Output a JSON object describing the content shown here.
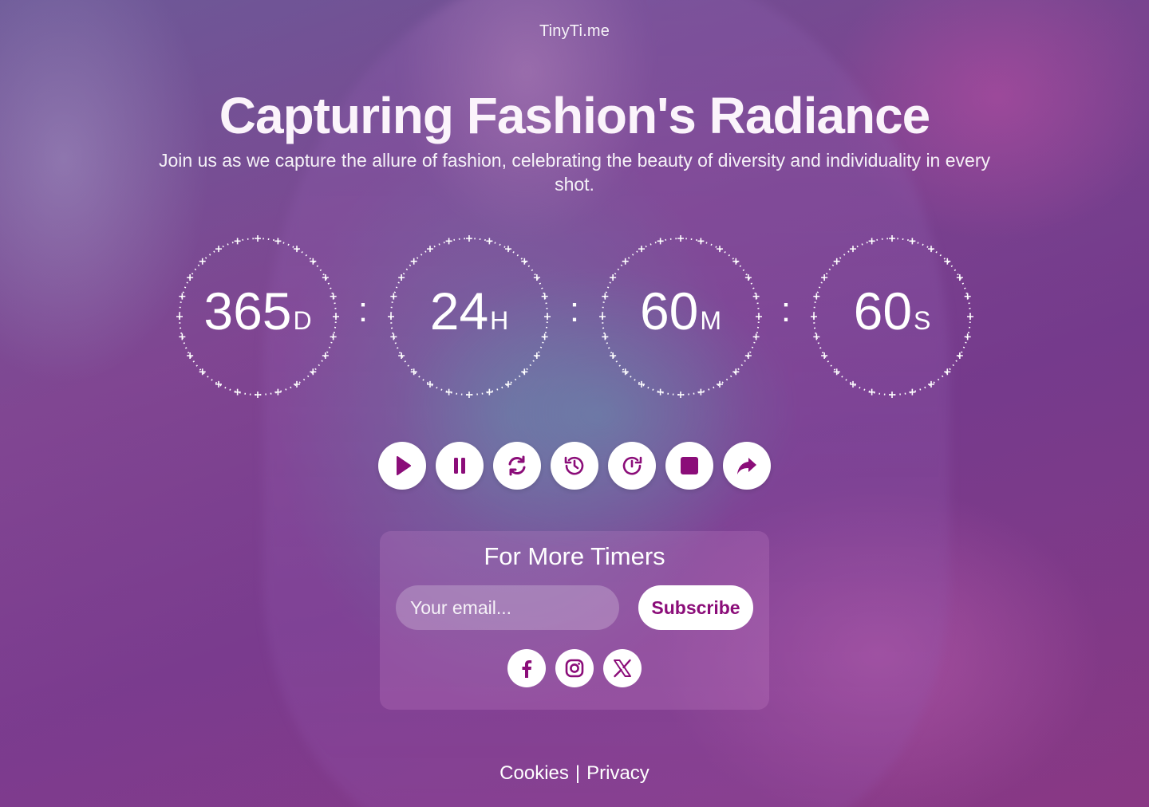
{
  "brand": "TinyTi.me",
  "hero": {
    "title": "Capturing Fashion's Radiance",
    "subtitle": "Join us as we capture the allure of fashion, celebrating the beauty of diversity and individuality in every shot."
  },
  "countdown": {
    "days": {
      "value": "365",
      "unit": "D"
    },
    "hours": {
      "value": "24",
      "unit": "H"
    },
    "minutes": {
      "value": "60",
      "unit": "M"
    },
    "seconds": {
      "value": "60",
      "unit": "S"
    },
    "separator": ":"
  },
  "controls": [
    {
      "name": "play-icon"
    },
    {
      "name": "pause-icon"
    },
    {
      "name": "refresh-icon"
    },
    {
      "name": "history-icon"
    },
    {
      "name": "restart-icon"
    },
    {
      "name": "stop-icon"
    },
    {
      "name": "share-icon"
    }
  ],
  "newsletter": {
    "title": "For More Timers",
    "email_placeholder": "Your email...",
    "subscribe_label": "Subscribe"
  },
  "social": [
    "facebook-icon",
    "instagram-icon",
    "x-icon"
  ],
  "footer": {
    "cookies": "Cookies",
    "separator": "|",
    "privacy": "Privacy"
  },
  "colors": {
    "accent": "#8b0d79",
    "button_bg": "#ffffff"
  }
}
